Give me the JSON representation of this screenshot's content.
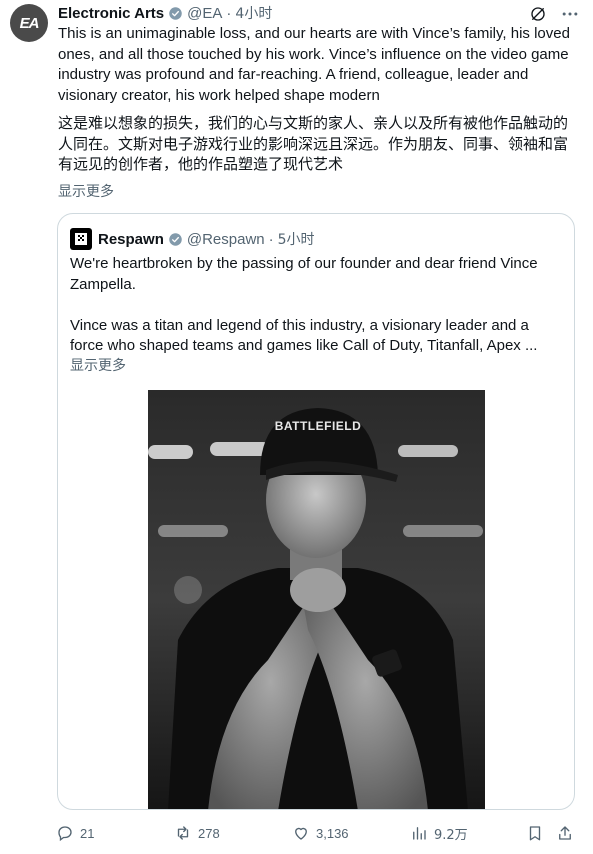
{
  "author": {
    "avatar_text": "EA",
    "name": "Electronic Arts",
    "handle": "@EA",
    "separator": "·",
    "time": "4小时"
  },
  "tweet": {
    "text_en": "This is an unimaginable loss, and our hearts are with Vince’s family, his loved ones, and all those touched by his work. Vince’s influence on the video game industry was profound and far-reaching. A friend, colleague, leader and visionary creator, his work helped shape modern",
    "text_cn": "这是难以想象的损失，我们的心与文斯的家人、亲人以及所有被他作品触动的人同在。文斯对电子游戏行业的影响深远且深远。作为朋友、同事、领袖和富有远见的创作者，他的作品塑造了现代艺术",
    "show_more": "显示更多"
  },
  "quote": {
    "name": "Respawn",
    "handle": "@Respawn",
    "separator": "·",
    "time": "5小时",
    "paragraph1": "We're heartbroken by the passing of our founder and dear friend Vince Zampella.",
    "paragraph2": "Vince was a titan and legend of this industry, a visionary leader and a force who shaped teams and games like Call of Duty, Titanfall, Apex ...",
    "show_more": "显示更多",
    "photo_cap_text": "BATTLEFIELD"
  },
  "actions": {
    "replies": "21",
    "reposts": "278",
    "likes": "3,136",
    "views": "9.2万"
  },
  "colors": {
    "text": "#0f1419",
    "secondary": "#536471",
    "border": "#cfd9de"
  }
}
